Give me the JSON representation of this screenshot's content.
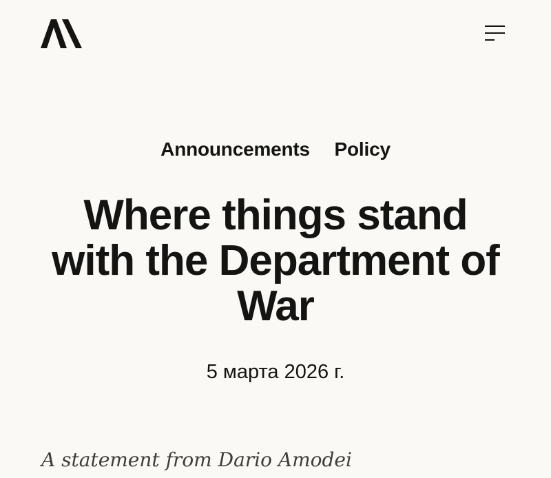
{
  "header": {
    "logo_icon": "anthropic-logo-icon",
    "menu_icon": "hamburger-menu-icon"
  },
  "article": {
    "tags": [
      {
        "label": "Announcements"
      },
      {
        "label": "Policy"
      }
    ],
    "title": "Where things stand with the Department of War",
    "date": "5 марта 2026 г.",
    "subtitle": "A statement from Dario Amodei"
  },
  "colors": {
    "background": "#faf9f5",
    "text": "#141413",
    "subtitle_text": "#3d3d3a"
  }
}
